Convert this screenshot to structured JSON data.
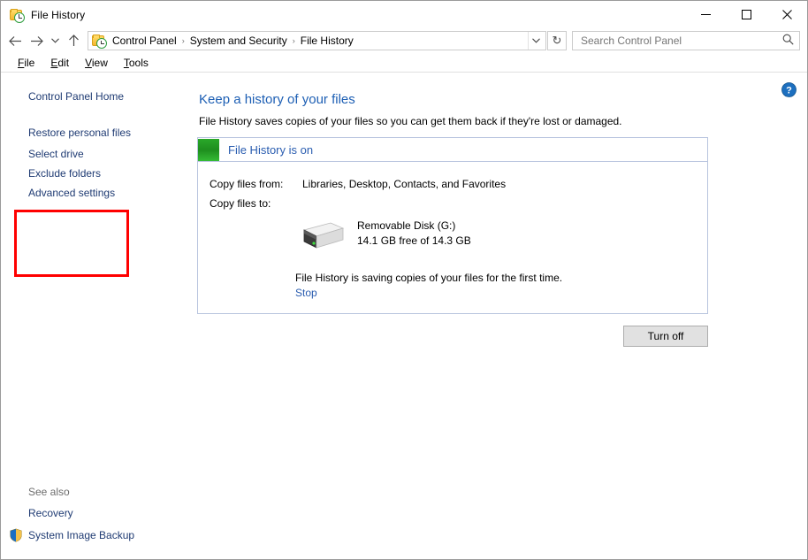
{
  "window": {
    "title": "File History",
    "app_icon": "file-history-icon",
    "controls": {
      "minimize": "minimize-icon",
      "maximize": "maximize-icon",
      "close": "close-icon"
    }
  },
  "navbar": {
    "back": "back-arrow-icon",
    "forward": "forward-arrow-icon",
    "recent": "chevron-down-icon",
    "up": "up-arrow-icon",
    "breadcrumb_icon": "file-history-icon",
    "breadcrumbs": [
      "Control Panel",
      "System and Security",
      "File History"
    ],
    "separator": "›",
    "dropdown": "chevron-down-icon",
    "refresh": "↻",
    "refresh_name": "refresh-icon"
  },
  "search": {
    "placeholder": "Search Control Panel",
    "value": "",
    "icon": "search-icon"
  },
  "menubar": {
    "items": [
      {
        "label": "File",
        "accel": "F",
        "rest": "ile"
      },
      {
        "label": "Edit",
        "accel": "E",
        "rest": "dit"
      },
      {
        "label": "View",
        "accel": "V",
        "rest": "iew"
      },
      {
        "label": "Tools",
        "accel": "T",
        "rest": "ools"
      }
    ]
  },
  "sidebar": {
    "home": "Control Panel Home",
    "restore": "Restore personal files",
    "highlighted": [
      "Select drive",
      "Exclude folders",
      "Advanced settings"
    ],
    "highlight_color": "#ff0000",
    "see_also_title": "See also",
    "see_also": [
      {
        "label": "Recovery",
        "icon": ""
      },
      {
        "label": "System Image Backup",
        "icon": "shield-icon"
      }
    ]
  },
  "main": {
    "help_icon": "help-icon",
    "heading": "Keep a history of your files",
    "subheading": "File History saves copies of your files so you can get them back if they're lost or damaged.",
    "status": {
      "label": "File History is on",
      "swatch_color": "#22a022",
      "swatch_name": "status-on-swatch"
    },
    "details": {
      "from_key": "Copy files from:",
      "from_value": "Libraries, Desktop, Contacts, and Favorites",
      "to_key": "Copy files to:",
      "drive_icon": "external-drive-icon",
      "drive_name": "Removable Disk (G:)",
      "drive_space": "14.1 GB free of 14.3 GB"
    },
    "progress": {
      "text": "File History is saving copies of your files for the first time.",
      "stop_label": "Stop"
    },
    "turn_off_label": "Turn off"
  },
  "colors": {
    "link_blue": "#1f3b73",
    "heading_blue": "#1d5fb4",
    "panel_border": "#b8c4de",
    "accent_red": "#ff0000"
  }
}
